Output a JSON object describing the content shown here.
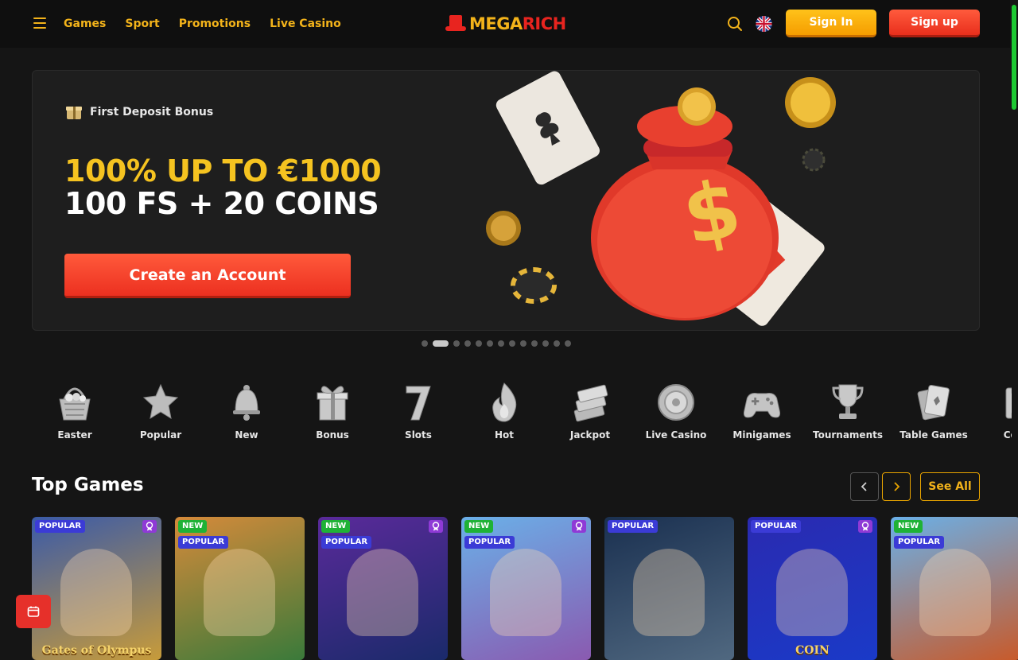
{
  "header": {
    "nav": [
      {
        "label": "Games"
      },
      {
        "label": "Sport"
      },
      {
        "label": "Promotions"
      },
      {
        "label": "Live Casino"
      }
    ],
    "logo": {
      "part1": "MEGA",
      "part2": "RICH"
    },
    "sign_in_label": "Sign In",
    "sign_up_label": "Sign up",
    "language": "en-GB flag"
  },
  "hero": {
    "tag": "First Deposit Bonus",
    "line1": "100% UP TO €1000",
    "line2": "100 FS + 20 COINS",
    "cta_label": "Create an Account",
    "slide_count": 13,
    "active_slide": 2
  },
  "categories": [
    {
      "label": "Easter",
      "icon": "basket-icon"
    },
    {
      "label": "Popular",
      "icon": "star-icon"
    },
    {
      "label": "New",
      "icon": "bell-icon"
    },
    {
      "label": "Bonus",
      "icon": "gift-icon"
    },
    {
      "label": "Slots",
      "icon": "seven-icon"
    },
    {
      "label": "Hot",
      "icon": "flame-icon"
    },
    {
      "label": "Jackpot",
      "icon": "money-stack-icon"
    },
    {
      "label": "Live Casino",
      "icon": "chip-icon"
    },
    {
      "label": "Minigames",
      "icon": "gamepad-icon"
    },
    {
      "label": "Tournaments",
      "icon": "trophy-icon"
    },
    {
      "label": "Table Games",
      "icon": "cards-icon"
    },
    {
      "label": "Collec",
      "icon": "collection-icon"
    }
  ],
  "top_games": {
    "title": "Top Games",
    "see_all_label": "See All",
    "prev_icon": "chevron-left-icon",
    "next_icon": "chevron-right-icon",
    "items": [
      {
        "badges": [
          "POPULAR"
        ],
        "fav": true,
        "art_text": "Gates of Olympus",
        "colors": [
          "#3a5aa8",
          "#c79b3a"
        ]
      },
      {
        "badges": [
          "NEW",
          "POPULAR"
        ],
        "fav": false,
        "art_text": "",
        "colors": [
          "#d58a3a",
          "#3a7a3a"
        ]
      },
      {
        "badges": [
          "NEW",
          "POPULAR"
        ],
        "fav": true,
        "art_text": "",
        "colors": [
          "#5a2a9a",
          "#1a2a6a"
        ]
      },
      {
        "badges": [
          "NEW",
          "POPULAR"
        ],
        "fav": true,
        "art_text": "",
        "colors": [
          "#6ab0e8",
          "#8a5ab0"
        ]
      },
      {
        "badges": [
          "POPULAR"
        ],
        "fav": false,
        "art_text": "",
        "colors": [
          "#1a3050",
          "#506880"
        ]
      },
      {
        "badges": [
          "POPULAR"
        ],
        "fav": true,
        "art_text": "COIN",
        "colors": [
          "#2a2ab0",
          "#1a3ac8"
        ]
      },
      {
        "badges": [
          "NEW",
          "POPULAR"
        ],
        "fav": false,
        "art_text": "",
        "colors": [
          "#6ab0e8",
          "#c85a2a"
        ]
      }
    ]
  },
  "colors": {
    "accent_yellow": "#f3b31a",
    "accent_red": "#e8241f",
    "background": "#151515",
    "scroll_thumb": "#1ec933"
  }
}
